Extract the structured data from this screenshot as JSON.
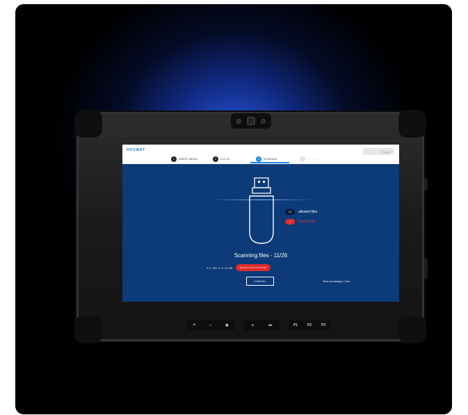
{
  "header": {
    "logo_text": "OPSWAT",
    "language_label": "English"
  },
  "steps": [
    {
      "number": "1",
      "label": "INSERT MEDIA",
      "state": "done"
    },
    {
      "number": "2",
      "label": "LOG IN",
      "state": "done"
    },
    {
      "number": "3",
      "label": "SCANNING",
      "state": "active"
    },
    {
      "number": "4",
      "label": "RESULTS",
      "state": "disabled"
    }
  ],
  "legend": {
    "allowed_count": "10",
    "allowed_label": "allowed files",
    "blocked_count": "1",
    "blocked_label": "blocked file"
  },
  "scan": {
    "title": "Scanning files - 11/26",
    "progress_text": "8.17 MB of 71.29 MB",
    "blocked_notice": "Blocked file (retrieval)",
    "cancel_label": "CANCEL",
    "time_remaining": "Time remaining: 2 min"
  },
  "hardware_buttons": {
    "group1": [
      "↶",
      "⌂",
      "◉"
    ],
    "group2": [
      "◂",
      "▸▸"
    ],
    "group3": [
      "P1",
      "P2",
      "P3"
    ]
  },
  "colors": {
    "screen_bg": "#0d3a78",
    "accent": "#1e88e5",
    "blocked": "#e02b2b",
    "backdrop_glow": "#285ae6"
  },
  "icons": {
    "usb": "usb-drive-icon"
  }
}
